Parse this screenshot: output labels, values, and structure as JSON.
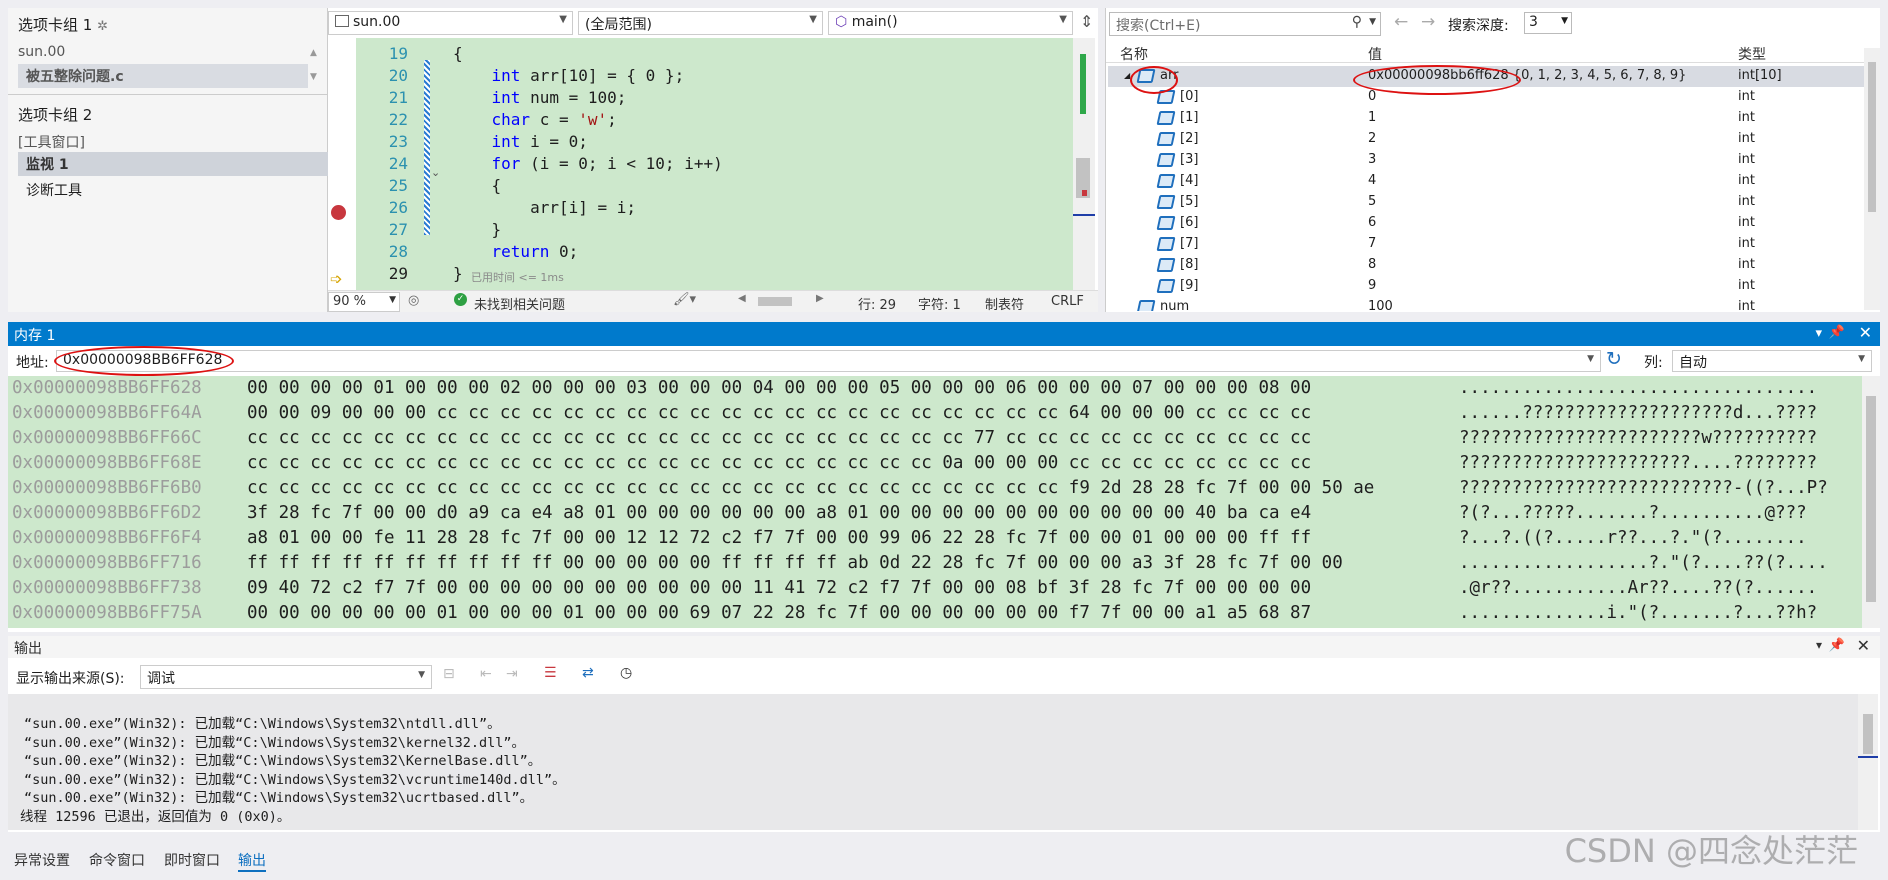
{
  "left_panel": {
    "group1_title": "选项卡组 1",
    "group1_items": [
      "sun.00",
      "被五整除问题.c"
    ],
    "group2_title": "选项卡组 2",
    "group2_category": "[工具窗口]",
    "group2_selected": "监视 1",
    "group2_item": "诊断工具"
  },
  "editor": {
    "file_combo": "sun.00",
    "scope_combo": "(全局范围)",
    "func_combo": "main()",
    "lines": [
      {
        "n": "19",
        "code": "{"
      },
      {
        "n": "20",
        "code": "    int arr[10] = { 0 };"
      },
      {
        "n": "21",
        "code": "    int num = 100;"
      },
      {
        "n": "22",
        "code": "    char c = 'w';"
      },
      {
        "n": "23",
        "code": "    int i = 0;"
      },
      {
        "n": "24",
        "code": "    for (i = 0; i < 10; i++)"
      },
      {
        "n": "25",
        "code": "    {"
      },
      {
        "n": "26",
        "code": "        arr[i] = i;"
      },
      {
        "n": "27",
        "code": "    }"
      },
      {
        "n": "28",
        "code": "    return 0;"
      },
      {
        "n": "29",
        "code": "} "
      }
    ],
    "elapsed_hint": "已用时间 <= 1ms",
    "status": {
      "zoom": "90 %",
      "issues": "未找到相关问题",
      "line": "行: 29",
      "char": "字符: 1",
      "tab": "制表符",
      "eol": "CRLF"
    }
  },
  "watch": {
    "search_placeholder": "搜索(Ctrl+E)",
    "depth_label": "搜索深度:",
    "depth_value": "3",
    "col_name": "名称",
    "col_value": "值",
    "col_type": "类型",
    "rows": [
      {
        "name": "arr",
        "value": "0x00000098bb6ff628 {0, 1, 2, 3, 4, 5, 6, 7, 8, 9}",
        "type": "int[10]"
      },
      {
        "name": "[0]",
        "value": "0",
        "type": "int"
      },
      {
        "name": "[1]",
        "value": "1",
        "type": "int"
      },
      {
        "name": "[2]",
        "value": "2",
        "type": "int"
      },
      {
        "name": "[3]",
        "value": "3",
        "type": "int"
      },
      {
        "name": "[4]",
        "value": "4",
        "type": "int"
      },
      {
        "name": "[5]",
        "value": "5",
        "type": "int"
      },
      {
        "name": "[6]",
        "value": "6",
        "type": "int"
      },
      {
        "name": "[7]",
        "value": "7",
        "type": "int"
      },
      {
        "name": "[8]",
        "value": "8",
        "type": "int"
      },
      {
        "name": "[9]",
        "value": "9",
        "type": "int"
      },
      {
        "name": "num",
        "value": "100",
        "type": "int"
      }
    ]
  },
  "memory": {
    "title": "内存 1",
    "address_label": "地址:",
    "address_value": "0x00000098BB6FF628",
    "col_label": "列:",
    "col_value": "自动",
    "rows": [
      {
        "addr": "0x00000098BB6FF628",
        "hex": "00 00 00 00 01 00 00 00 02 00 00 00 03 00 00 00 04 00 00 00 05 00 00 00 06 00 00 00 07 00 00 00 08 00",
        "ascii": ".................................."
      },
      {
        "addr": "0x00000098BB6FF64A",
        "hex": "00 00 09 00 00 00 cc cc cc cc cc cc cc cc cc cc cc cc cc cc cc cc cc cc cc cc 64 00 00 00 cc cc cc cc",
        "ascii": "......????????????????????d...????"
      },
      {
        "addr": "0x00000098BB6FF66C",
        "hex": "cc cc cc cc cc cc cc cc cc cc cc cc cc cc cc cc cc cc cc cc cc cc cc 77 cc cc cc cc cc cc cc cc cc cc",
        "ascii": "???????????????????????w??????????"
      },
      {
        "addr": "0x00000098BB6FF68E",
        "hex": "cc cc cc cc cc cc cc cc cc cc cc cc cc cc cc cc cc cc cc cc cc cc 0a 00 00 00 cc cc cc cc cc cc cc cc",
        "ascii": "??????????????????????....????????"
      },
      {
        "addr": "0x00000098BB6FF6B0",
        "hex": "cc cc cc cc cc cc cc cc cc cc cc cc cc cc cc cc cc cc cc cc cc cc cc cc cc cc f9 2d 28 28 fc 7f 00 00 50 ae",
        "ascii": "??????????????????????????-((?...P?"
      },
      {
        "addr": "0x00000098BB6FF6D2",
        "hex": "3f 28 fc 7f 00 00 d0 a9 ca e4 a8 01 00 00 00 00 00 00 a8 01 00 00 00 00 00 00 00 00 00 00 40 ba ca e4",
        "ascii": "?(?...?????.......?..........@???"
      },
      {
        "addr": "0x00000098BB6FF6F4",
        "hex": "a8 01 00 00 fe 11 28 28 fc 7f 00 00 12 12 72 c2 f7 7f 00 00 99 06 22 28 fc 7f 00 00 01 00 00 00 ff ff",
        "ascii": "?...?.((?.....r??...?.\"(?........"
      },
      {
        "addr": "0x00000098BB6FF716",
        "hex": "ff ff ff ff ff ff ff ff ff ff 00 00 00 00 00 ff ff ff ff ab 0d 22 28 fc 7f 00 00 00 a3 3f 28 fc 7f 00 00",
        "ascii": "..................?.\"(?....??(?...."
      },
      {
        "addr": "0x00000098BB6FF738",
        "hex": "09 40 72 c2 f7 7f 00 00 00 00 00 00 00 00 00 00 11 41 72 c2 f7 7f 00 00 08 bf 3f 28 fc 7f 00 00 00 00",
        "ascii": ".@r??...........Ar??....??(?......"
      },
      {
        "addr": "0x00000098BB6FF75A",
        "hex": "00 00 00 00 00 00 01 00 00 00 01 00 00 00 69 07 22 28 fc 7f 00 00 00 00 00 00 f7 7f 00 00 a1 a5 68 87",
        "ascii": "..............i.\"(?.......?...??h?"
      }
    ]
  },
  "output": {
    "title": "输出",
    "source_label": "显示输出来源(S):",
    "source_value": "调试",
    "lines": [
      "“sun.00.exe”(Win32): 已加载“C:\\Windows\\System32\\ntdll.dll”。",
      "“sun.00.exe”(Win32): 已加载“C:\\Windows\\System32\\kernel32.dll”。",
      "“sun.00.exe”(Win32): 已加载“C:\\Windows\\System32\\KernelBase.dll”。",
      "“sun.00.exe”(Win32): 已加载“C:\\Windows\\System32\\vcruntime140d.dll”。",
      "“sun.00.exe”(Win32): 已加载“C:\\Windows\\System32\\ucrtbased.dll”。",
      "线程 12596 已退出，返回值为 0 (0x0)。"
    ]
  },
  "bottom_tabs": [
    "异常设置",
    "命令窗口",
    "即时窗口",
    "输出"
  ],
  "watermark": "CSDN @四念处茫茫",
  "colors": {
    "accent": "#007acc",
    "code_bg": "#cde8cc",
    "annotation": "#dd1111"
  }
}
